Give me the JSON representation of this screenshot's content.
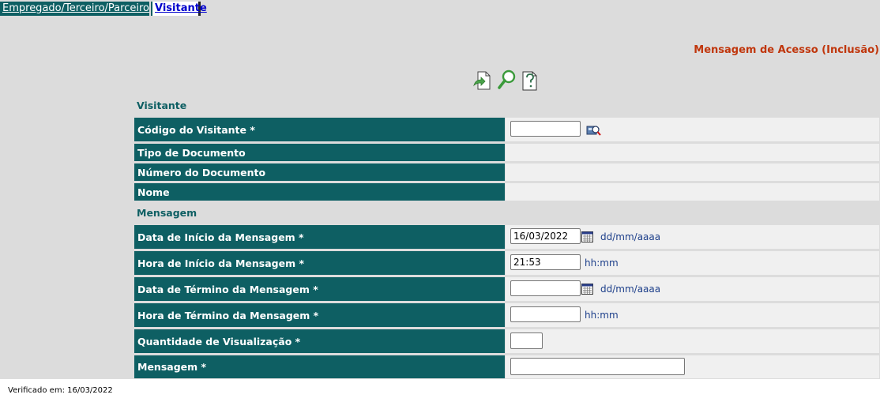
{
  "tabs": [
    {
      "label": "Empregado/Terceiro/Parceiro"
    },
    {
      "label": "Visitante"
    }
  ],
  "page_title": "Mensagem de Acesso (Inclusão)",
  "toolbar": {
    "icons": [
      "send-document-icon",
      "search-icon",
      "help-document-icon"
    ]
  },
  "sections": {
    "visitante": "Visitante",
    "mensagem": "Mensagem"
  },
  "fields": {
    "codigo_visitante": {
      "label": "Código do Visitante *",
      "value": ""
    },
    "tipo_documento": {
      "label": "Tipo de Documento",
      "value": ""
    },
    "numero_documento": {
      "label": "Número do Documento",
      "value": ""
    },
    "nome": {
      "label": "Nome",
      "value": ""
    },
    "data_inicio": {
      "label": "Data de Início da Mensagem *",
      "value": "16/03/2022",
      "hint": "dd/mm/aaaa"
    },
    "hora_inicio": {
      "label": "Hora de Início da Mensagem *",
      "value": "21:53",
      "hint": "hh:mm"
    },
    "data_termino": {
      "label": "Data de Término da Mensagem *",
      "value": "",
      "hint": "dd/mm/aaaa"
    },
    "hora_termino": {
      "label": "Hora de Término da Mensagem *",
      "value": "",
      "hint": "hh:mm"
    },
    "quantidade_visualizacao": {
      "label": "Quantidade de Visualização *",
      "value": ""
    },
    "mensagem": {
      "label": "Mensagem *",
      "value": ""
    }
  },
  "footer": "Verificado em: 16/03/2022",
  "colors": {
    "header_teal": "#0e5f63",
    "title_orange": "#c0360c",
    "hint_blue": "#1d3f8a",
    "background": "#dcdcdc"
  }
}
